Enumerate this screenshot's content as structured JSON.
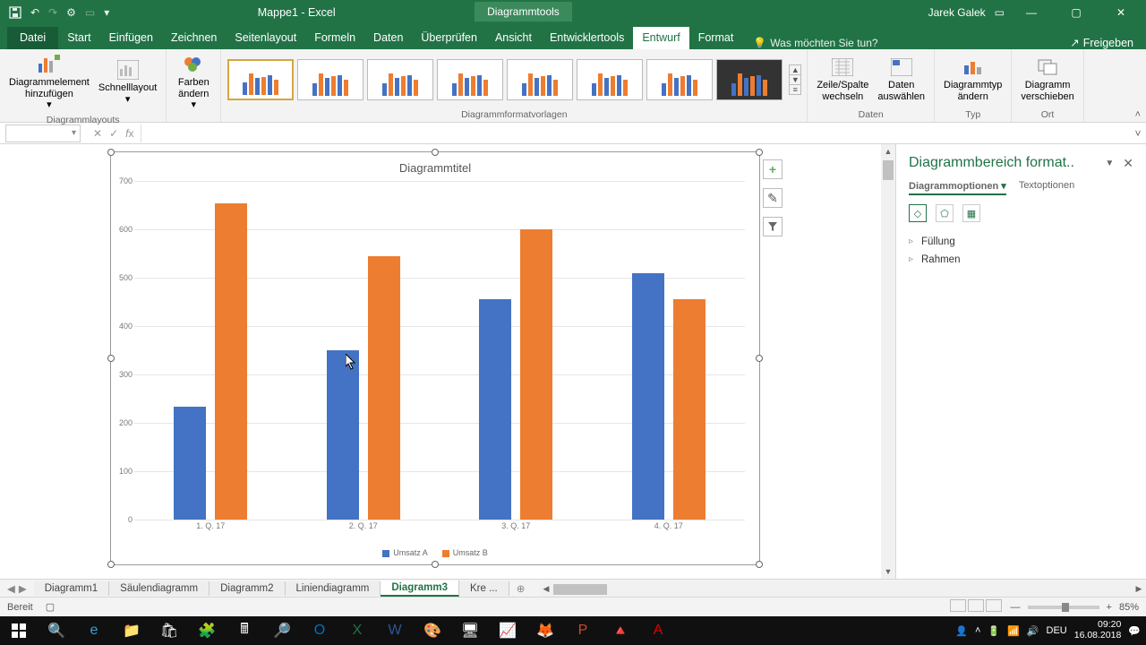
{
  "title": "Mappe1 - Excel",
  "context_tab": "Diagrammtools",
  "user": "Jarek Galek",
  "menu": {
    "file": "Datei",
    "tabs": [
      "Start",
      "Einfügen",
      "Zeichnen",
      "Seitenlayout",
      "Formeln",
      "Daten",
      "Überprüfen",
      "Ansicht",
      "Entwicklertools",
      "Entwurf",
      "Format"
    ],
    "active": "Entwurf",
    "tellme": "Was möchten Sie tun?",
    "share": "Freigeben"
  },
  "ribbon": {
    "group1": {
      "btn1": "Diagrammelement\nhinzufügen",
      "btn2": "Schnelllayout",
      "label": "Diagrammlayouts"
    },
    "group2": {
      "btn": "Farben\nändern"
    },
    "group3": {
      "label": "Diagrammformatvorlagen"
    },
    "group4": {
      "btn1": "Zeile/Spalte\nwechseln",
      "btn2": "Daten\nauswählen",
      "label": "Daten"
    },
    "group5": {
      "btn": "Diagrammtyp\nändern",
      "label": "Typ"
    },
    "group6": {
      "btn": "Diagramm\nverschieben",
      "label": "Ort"
    }
  },
  "formula_bar": {
    "name": "",
    "value": ""
  },
  "chart_data": {
    "type": "bar",
    "title": "Diagrammtitel",
    "categories": [
      "1. Q. 17",
      "2. Q. 17",
      "3. Q. 17",
      "4. Q. 17"
    ],
    "series": [
      {
        "name": "Umsatz A",
        "color": "#4472c4",
        "values": [
          234,
          350,
          455,
          510
        ]
      },
      {
        "name": "Umsatz B",
        "color": "#ed7d31",
        "values": [
          653,
          545,
          600,
          455
        ]
      }
    ],
    "ylabel": "",
    "xlabel": "",
    "ylim": [
      0,
      700
    ],
    "yticks": [
      0,
      100,
      200,
      300,
      400,
      500,
      600,
      700
    ]
  },
  "chart_controls": {
    "add": "+",
    "brush": "✎",
    "filter": "▾"
  },
  "format_pane": {
    "title": "Diagrammbereich format..",
    "tab1": "Diagrammoptionen",
    "tab2": "Textoptionen",
    "section1": "Füllung",
    "section2": "Rahmen"
  },
  "sheets": {
    "list": [
      "Diagramm1",
      "Säulendiagramm",
      "Diagramm2",
      "Liniendiagramm",
      "Diagramm3",
      "Kre ..."
    ],
    "active": "Diagramm3"
  },
  "status": {
    "ready": "Bereit",
    "zoom": "85%",
    "zoom_sign": "+"
  },
  "system": {
    "lang": "DEU",
    "time": "09:20",
    "date": "16.08.2018"
  }
}
